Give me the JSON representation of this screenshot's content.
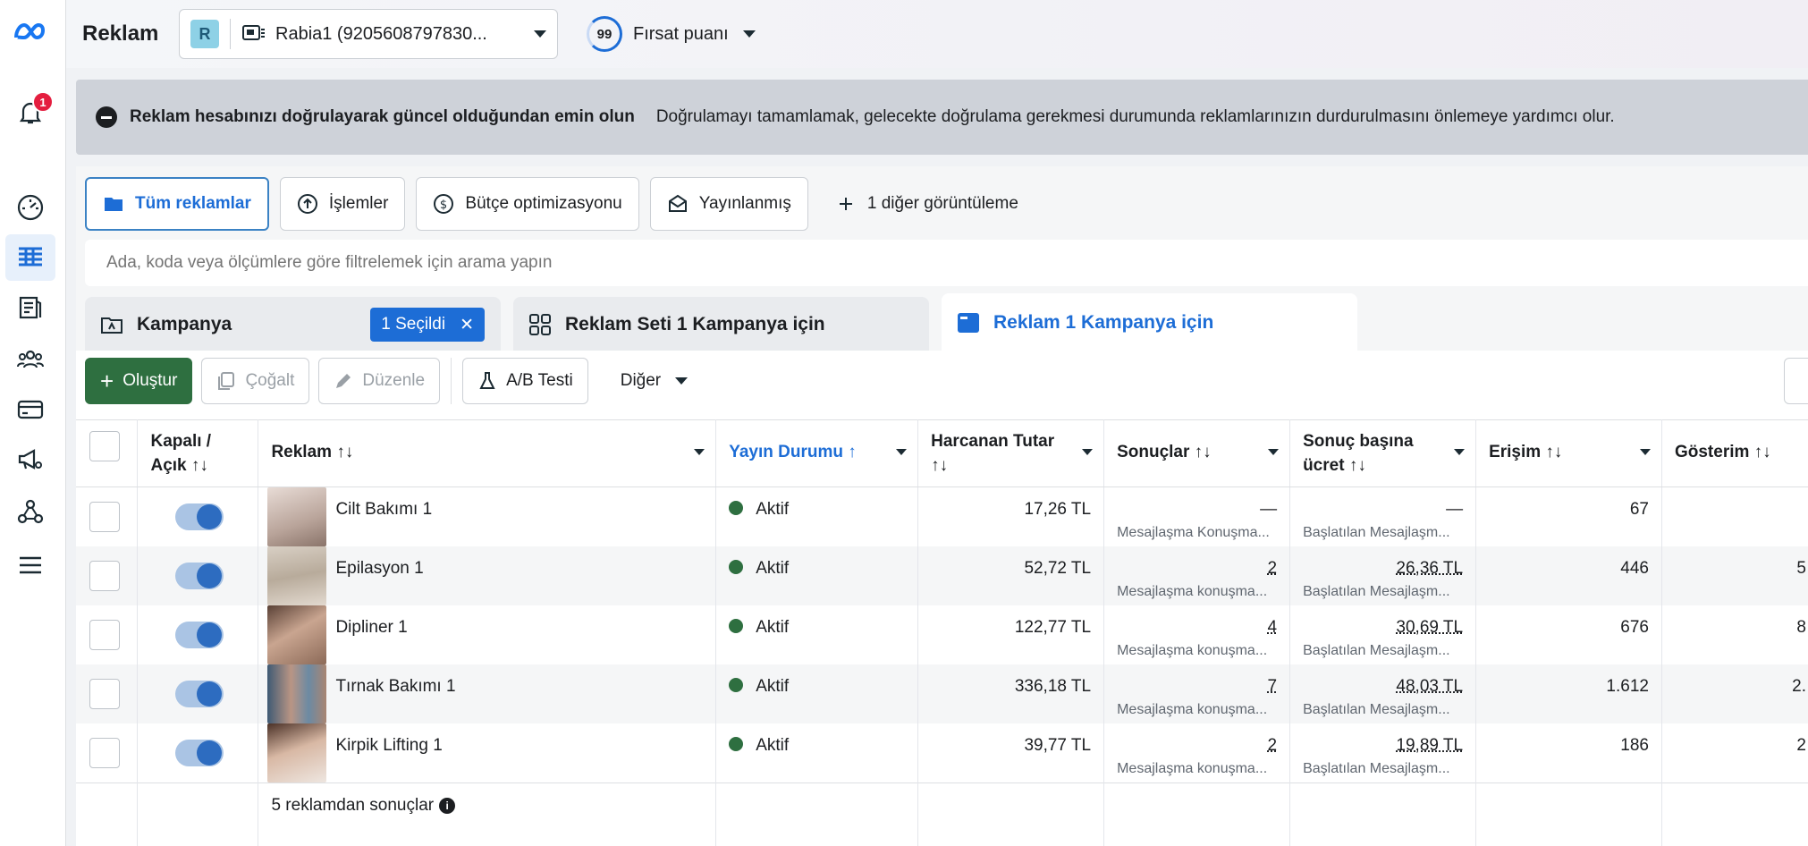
{
  "app": {
    "brand": "Reklam",
    "notification_count": "1"
  },
  "account": {
    "initial": "R",
    "name": "Rabia1 (9205608797830..."
  },
  "opportunity": {
    "score": "99",
    "label": "Fırsat puanı"
  },
  "alert": {
    "title": "Reklam hesabınızı doğrulayarak güncel olduğundan emin olun",
    "text": "Doğrulamayı tamamlamak, gelecekte doğrulama gerekmesi durumunda reklamlarınızın durdurulmasını önlemeye yardımcı olur."
  },
  "views": [
    {
      "label": "Tüm reklamlar",
      "icon": "folder-icon"
    },
    {
      "label": "İşlemler",
      "icon": "upload-icon"
    },
    {
      "label": "Bütçe optimizasyonu",
      "icon": "dollar-icon"
    },
    {
      "label": "Yayınlanmış",
      "icon": "envelope-icon"
    },
    {
      "label": "1 diğer görüntüleme",
      "icon": "plus-icon"
    }
  ],
  "search": {
    "placeholder": "Ada, koda veya ölçümlere göre filtrelemek için arama yapın"
  },
  "tabs": {
    "campaign": "Kampanya",
    "selected_chip": "1 Seçildi",
    "adset": "Reklam Seti 1 Kampanya için",
    "ad": "Reklam 1 Kampanya için"
  },
  "toolbar": {
    "create": "Oluştur",
    "duplicate": "Çoğalt",
    "edit": "Düzenle",
    "ab_test": "A/B Testi",
    "more": "Diğer"
  },
  "table": {
    "headers": {
      "toggle": [
        "Kapalı /",
        "Açık ↑↓"
      ],
      "ad": "Reklam ↑↓",
      "status": "Yayın Durumu ↑",
      "spent": [
        "Harcanan Tutar",
        "↑↓"
      ],
      "results": "Sonuçlar ↑↓",
      "cost": [
        "Sonuç başına",
        "ücret ↑↓"
      ],
      "reach": "Erişim ↑↓",
      "impressions": "Gösterim ↑↓"
    },
    "rows": [
      {
        "name": "Cilt Bakımı 1",
        "status": "Aktif",
        "spent": "17,26 TL",
        "results": "—",
        "results_sub": "Mesajlaşma Konuşma...",
        "cost": "—",
        "cost_sub": "Başlatılan Mesajlaşm...",
        "reach": "67",
        "impressions": ""
      },
      {
        "name": "Epilasyon 1",
        "status": "Aktif",
        "spent": "52,72 TL",
        "results": "2",
        "results_sub": "Mesajlaşma konuşma...",
        "cost": "26,36 TL",
        "cost_sub": "Başlatılan Mesajlaşm...",
        "reach": "446",
        "impressions": "5"
      },
      {
        "name": "Dipliner 1",
        "status": "Aktif",
        "spent": "122,77 TL",
        "results": "4",
        "results_sub": "Mesajlaşma konuşma...",
        "cost": "30,69 TL",
        "cost_sub": "Başlatılan Mesajlaşm...",
        "reach": "676",
        "impressions": "8"
      },
      {
        "name": "Tırnak Bakımı 1",
        "status": "Aktif",
        "spent": "336,18 TL",
        "results": "7",
        "results_sub": "Mesajlaşma konuşma...",
        "cost": "48,03 TL",
        "cost_sub": "Başlatılan Mesajlaşm...",
        "reach": "1.612",
        "impressions": "2."
      },
      {
        "name": "Kirpik Lifting 1",
        "status": "Aktif",
        "spent": "39,77 TL",
        "results": "2",
        "results_sub": "Mesajlaşma konuşma...",
        "cost": "19,89 TL",
        "cost_sub": "Başlatılan Mesajlaşm...",
        "reach": "186",
        "impressions": "2"
      }
    ],
    "footer": "5 reklamdan sonuçlar"
  },
  "colors": {
    "accent": "#1d6dd6",
    "create_button": "#2e6f40",
    "active_status": "#2e6f40"
  }
}
